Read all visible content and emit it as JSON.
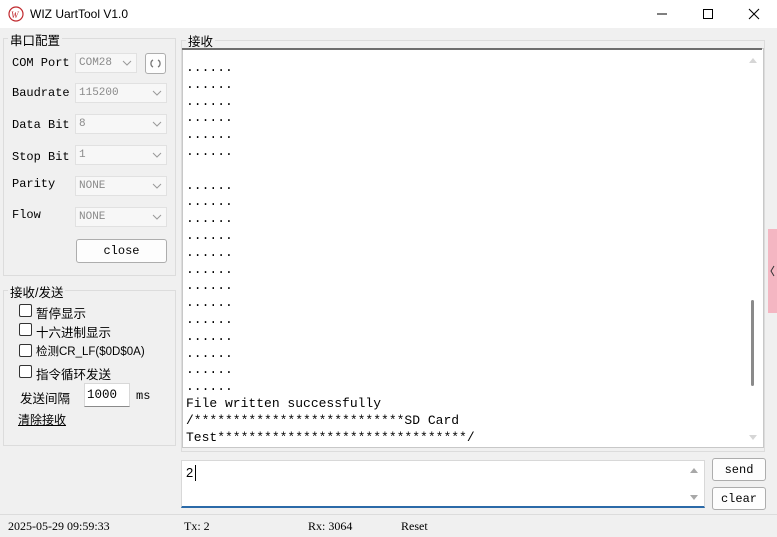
{
  "window": {
    "title": "WIZ UartTool V1.0",
    "controls": [
      "minimize",
      "maximize",
      "close"
    ]
  },
  "serial_config": {
    "group_title": "串口配置",
    "fields": [
      {
        "label": "COM Port",
        "value": "COM28"
      },
      {
        "label": "Baudrate",
        "value": "115200"
      },
      {
        "label": "Data Bit",
        "value": "8"
      },
      {
        "label": "Stop Bit",
        "value": "1"
      },
      {
        "label": "Parity",
        "value": "NONE"
      },
      {
        "label": "Flow",
        "value": "NONE"
      }
    ],
    "refresh_icon": "refresh-icon",
    "close_button": "close"
  },
  "rxtx_settings": {
    "group_title": "接收/发送",
    "checkboxes": [
      {
        "label": "暂停显示",
        "checked": false
      },
      {
        "label": "十六进制显示",
        "checked": false
      },
      {
        "label": "检测CR_LF($0D$0A)",
        "checked": false
      },
      {
        "label": "指令循环发送",
        "checked": false
      }
    ],
    "interval_label": "发送间隔",
    "interval_value": "1000",
    "interval_unit": "ms",
    "clear_rx_link": "清除接收"
  },
  "receive": {
    "group_title": "接收",
    "lines": [
      "......",
      "......",
      "......",
      "......",
      "......",
      "......",
      "",
      "......",
      "......",
      "......",
      "......",
      "......",
      "......",
      "......",
      "......",
      "......",
      "......",
      "......",
      "......",
      "......",
      "File written successfully",
      "/***************************SD Card",
      "Test********************************/"
    ]
  },
  "send": {
    "input_value": "2",
    "send_button": "send",
    "clear_button": "clear"
  },
  "status": {
    "datetime": "2025-05-29 09:59:33",
    "tx": "Tx: 2",
    "rx": "Rx: 3064",
    "reset": "Reset"
  }
}
